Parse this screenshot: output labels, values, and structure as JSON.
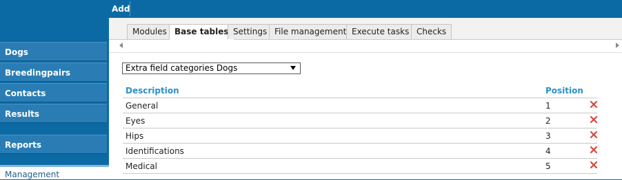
{
  "topbar": {
    "add_label": "Add"
  },
  "sidebar": {
    "items": [
      {
        "label": "Dogs"
      },
      {
        "label": "Breedingpairs"
      },
      {
        "label": "Contacts"
      },
      {
        "label": "Results"
      },
      {
        "label": "Reports"
      }
    ],
    "bottom_label": "Management"
  },
  "tabs": [
    {
      "label": "Modules"
    },
    {
      "label": "Base tables"
    },
    {
      "label": "Settings"
    },
    {
      "label": "File management"
    },
    {
      "label": "Execute tasks"
    },
    {
      "label": "Checks"
    }
  ],
  "active_tab": "Base tables",
  "table_select": {
    "value": "Extra field categories Dogs"
  },
  "table": {
    "headers": {
      "description": "Description",
      "position": "Position"
    },
    "rows": [
      {
        "description": "General",
        "position": "1"
      },
      {
        "description": "Eyes",
        "position": "2"
      },
      {
        "description": "Hips",
        "position": "3"
      },
      {
        "description": "Identifications",
        "position": "4"
      },
      {
        "description": "Medical",
        "position": "5"
      }
    ]
  },
  "colors": {
    "brand_blue": "#0b6aa3",
    "sidebar_item": "#2a7db4",
    "header_text": "#2a90c8",
    "delete_red": "#d9453c"
  },
  "icons": {
    "delete": "red-x-icon",
    "scroll_left": "arrow-left-icon",
    "scroll_right": "arrow-right-icon"
  }
}
